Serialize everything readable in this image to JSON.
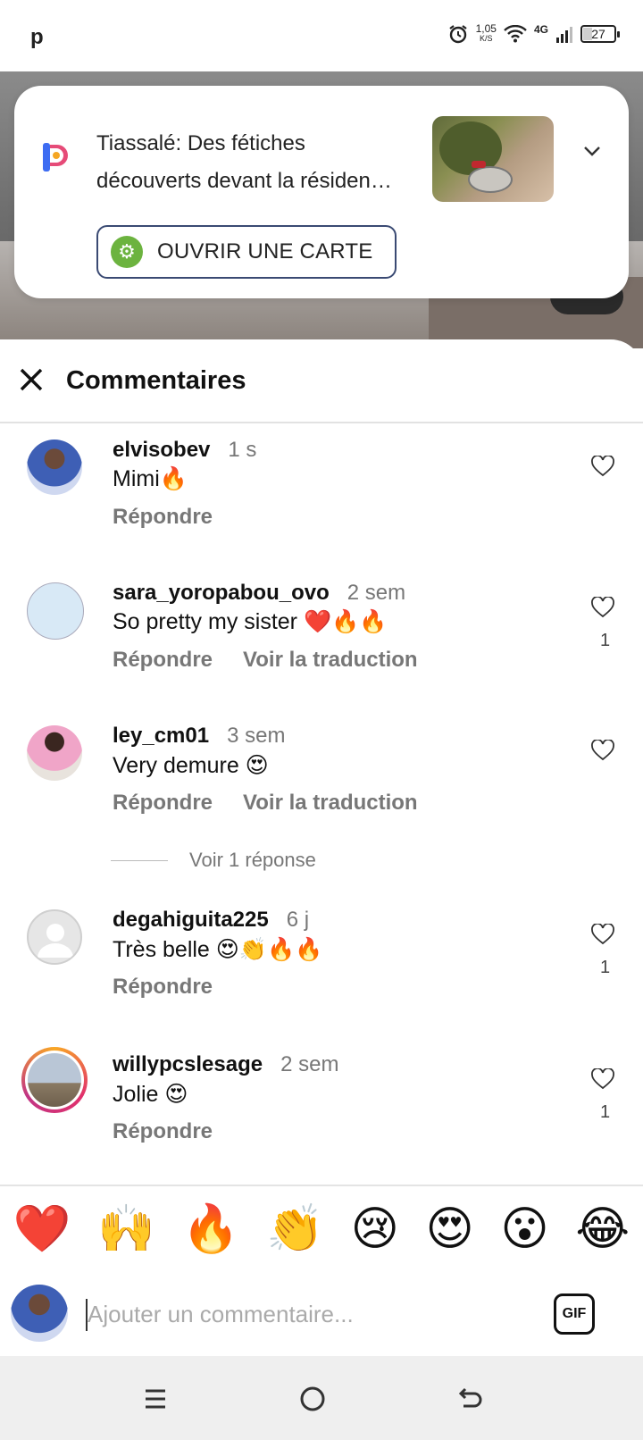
{
  "status_bar": {
    "app_letter": "p",
    "speed_value": "1,05",
    "speed_unit": "K/S",
    "network": "4G",
    "battery": "27",
    "battery_level": 0.27
  },
  "notification": {
    "title_line1": "Tiassalé: Des fétiches",
    "title_line2": "découverts devant la résiden…",
    "open_button": "OUVRIR UNE CARTE"
  },
  "comments_panel": {
    "title": "Commentaires",
    "comments": [
      {
        "username": "elvisobev",
        "time": "1 s",
        "text": "Mimi🔥",
        "actions": [
          "Répondre"
        ],
        "likes": ""
      },
      {
        "username": "sara_yoropabou_ovo",
        "time": "2 sem",
        "text": "So pretty my sister ❤️🔥🔥",
        "actions": [
          "Répondre",
          "Voir la traduction"
        ],
        "likes": "1"
      },
      {
        "username": "ley_cm01",
        "time": "3 sem",
        "text": "Very demure 😍",
        "actions": [
          "Répondre",
          "Voir la traduction"
        ],
        "likes": ""
      },
      {
        "username": "degahiguita225",
        "time": "6 j",
        "text": "Très belle 😍👏🔥🔥",
        "actions": [
          "Répondre"
        ],
        "likes": "1"
      },
      {
        "username": "willypcslesage",
        "time": "2 sem",
        "text": "Jolie 😍",
        "actions": [
          "Répondre"
        ],
        "likes": "1"
      }
    ],
    "view_replies": "Voir 1 réponse"
  },
  "reactions": [
    "❤️",
    "🙌",
    "🔥",
    "👏",
    "😢",
    "😍",
    "😮",
    "😂"
  ],
  "composer": {
    "placeholder": "Ajouter un commentaire...",
    "gif_label": "GIF"
  },
  "colors": {
    "accent_button_border": "#3a4a73",
    "open_icon_green": "#6cb33f",
    "muted_text": "#777777"
  }
}
